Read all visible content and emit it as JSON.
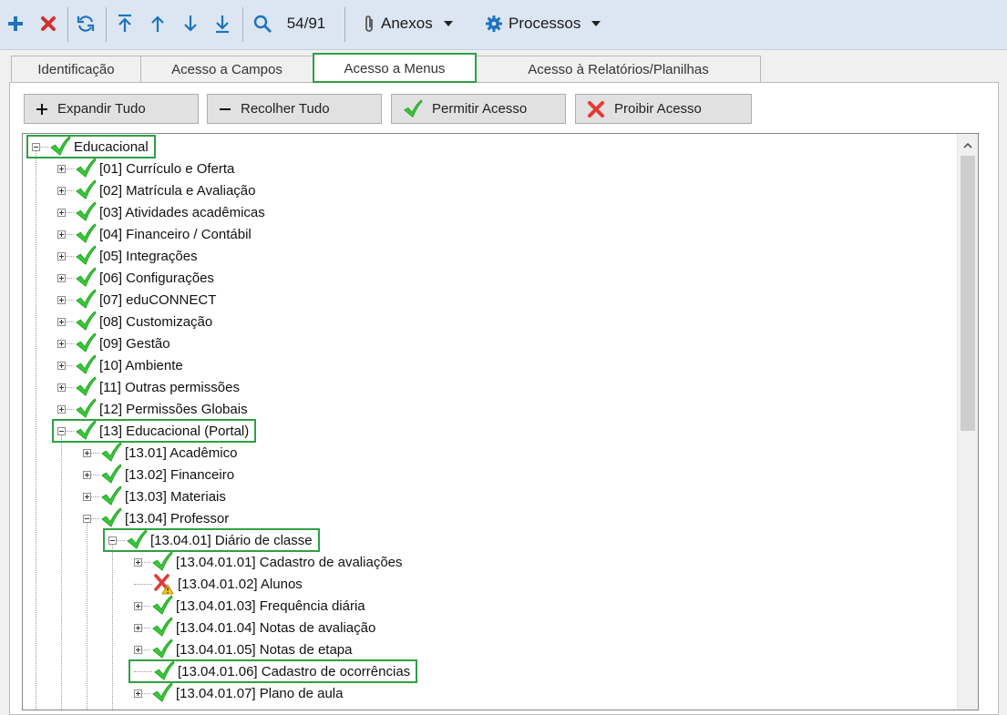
{
  "toolbar": {
    "record_counter": "54/91",
    "attachments_label": "Anexos",
    "processes_label": "Processos"
  },
  "tabs": [
    {
      "label": "Identificação"
    },
    {
      "label": "Acesso a Campos"
    },
    {
      "label": "Acesso a Menus",
      "active": true
    },
    {
      "label": "Acesso à Relatórios/Planilhas"
    }
  ],
  "actions": {
    "expand_all": "Expandir Tudo",
    "collapse_all": "Recolher Tudo",
    "allow_access": "Permitir Acesso",
    "deny_access": "Proibir Acesso"
  },
  "colors": {
    "allowed": "#33cc33",
    "denied": "#e53935",
    "highlight": "#2ea043",
    "toolbar_bg": "#dce6f2"
  },
  "tree": [
    {
      "label": "Educacional",
      "level": 0,
      "state": "expanded",
      "access": "allowed",
      "highlighted": true
    },
    {
      "label": "[01] Currículo e Oferta",
      "level": 1,
      "state": "collapsed",
      "access": "allowed"
    },
    {
      "label": "[02] Matrícula e Avaliação",
      "level": 1,
      "state": "collapsed",
      "access": "allowed"
    },
    {
      "label": "[03] Atividades acadêmicas",
      "level": 1,
      "state": "collapsed",
      "access": "allowed"
    },
    {
      "label": "[04] Financeiro / Contábil",
      "level": 1,
      "state": "collapsed",
      "access": "allowed"
    },
    {
      "label": "[05] Integrações",
      "level": 1,
      "state": "collapsed",
      "access": "allowed"
    },
    {
      "label": "[06] Configurações",
      "level": 1,
      "state": "collapsed",
      "access": "allowed"
    },
    {
      "label": "[07] eduCONNECT",
      "level": 1,
      "state": "collapsed",
      "access": "allowed"
    },
    {
      "label": "[08] Customização",
      "level": 1,
      "state": "collapsed",
      "access": "allowed"
    },
    {
      "label": "[09] Gestão",
      "level": 1,
      "state": "collapsed",
      "access": "allowed"
    },
    {
      "label": "[10] Ambiente",
      "level": 1,
      "state": "collapsed",
      "access": "allowed"
    },
    {
      "label": "[11] Outras permissões",
      "level": 1,
      "state": "collapsed",
      "access": "allowed"
    },
    {
      "label": "[12] Permissões Globais",
      "level": 1,
      "state": "collapsed",
      "access": "allowed"
    },
    {
      "label": "[13] Educacional (Portal)",
      "level": 1,
      "state": "expanded",
      "access": "allowed",
      "highlighted": true
    },
    {
      "label": "[13.01] Acadêmico",
      "level": 2,
      "state": "collapsed",
      "access": "allowed"
    },
    {
      "label": "[13.02] Financeiro",
      "level": 2,
      "state": "collapsed",
      "access": "allowed"
    },
    {
      "label": "[13.03] Materiais",
      "level": 2,
      "state": "collapsed",
      "access": "allowed"
    },
    {
      "label": "[13.04] Professor",
      "level": 2,
      "state": "expanded",
      "access": "allowed"
    },
    {
      "label": "[13.04.01] Diário de classe",
      "level": 3,
      "state": "expanded",
      "access": "allowed",
      "highlighted": true
    },
    {
      "label": "[13.04.01.01] Cadastro de avaliações",
      "level": 4,
      "state": "collapsed",
      "access": "allowed"
    },
    {
      "label": "[13.04.01.02] Alunos",
      "level": 4,
      "state": "leaf",
      "access": "denied"
    },
    {
      "label": "[13.04.01.03] Frequência diária",
      "level": 4,
      "state": "collapsed",
      "access": "allowed"
    },
    {
      "label": "[13.04.01.04] Notas de avaliação",
      "level": 4,
      "state": "collapsed",
      "access": "allowed"
    },
    {
      "label": "[13.04.01.05] Notas de etapa",
      "level": 4,
      "state": "collapsed",
      "access": "allowed"
    },
    {
      "label": "[13.04.01.06] Cadastro de ocorrências",
      "level": 4,
      "state": "leaf",
      "access": "allowed",
      "highlighted": true
    },
    {
      "label": "[13.04.01.07] Plano de aula",
      "level": 4,
      "state": "collapsed",
      "access": "allowed"
    }
  ]
}
